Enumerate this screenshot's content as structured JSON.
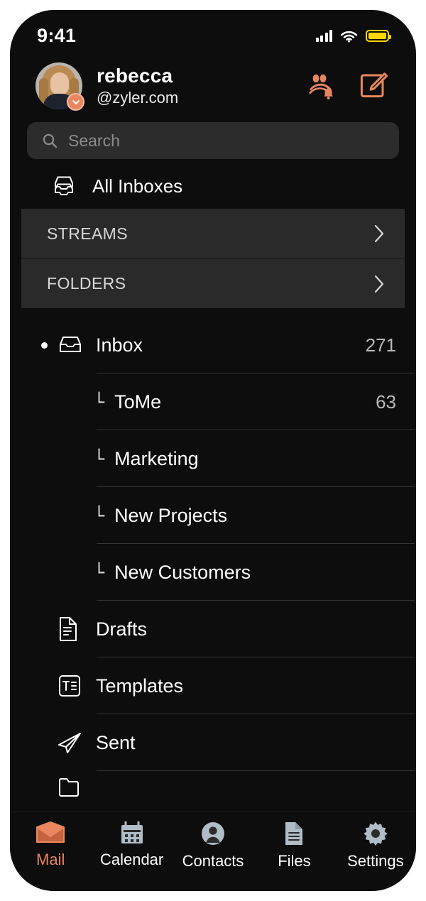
{
  "status_bar": {
    "time": "9:41",
    "signal_icon": "cellular-signal-icon",
    "wifi_icon": "wifi-icon",
    "battery_icon": "battery-icon",
    "battery_color": "#ffd60a"
  },
  "account": {
    "name": "rebecca",
    "domain": "@zyler.com",
    "avatar_name": "user-avatar",
    "avatar_badge_icon": "chevron-down-icon",
    "actions": [
      {
        "icon": "contacts-notification-icon",
        "color": "#e8875f"
      },
      {
        "icon": "compose-icon",
        "color": "#e8875f"
      }
    ]
  },
  "search": {
    "placeholder": "Search",
    "value": "",
    "icon": "search-icon"
  },
  "all_inboxes": {
    "label": "All Inboxes",
    "icon": "all-inboxes-tray-icon"
  },
  "sections": [
    {
      "title": "STREAMS",
      "chevron": "chevron-right-icon"
    },
    {
      "title": "FOLDERS",
      "chevron": "chevron-right-icon"
    }
  ],
  "mailboxes": [
    {
      "label": "Inbox",
      "count": "271",
      "icon": "inbox-tray-icon",
      "level": 0,
      "unread_dot": true
    },
    {
      "label": "ToMe",
      "count": "63",
      "icon": "branch-icon",
      "level": 1,
      "branch": "└"
    },
    {
      "label": "Marketing",
      "count": "",
      "icon": "branch-icon",
      "level": 1,
      "branch": "└"
    },
    {
      "label": "New Projects",
      "count": "",
      "icon": "branch-icon",
      "level": 1,
      "branch": "└"
    },
    {
      "label": "New Customers",
      "count": "",
      "icon": "branch-icon",
      "level": 1,
      "branch": "└"
    },
    {
      "label": "Drafts",
      "count": "",
      "icon": "drafts-document-icon",
      "level": 0,
      "unread_dot": false
    },
    {
      "label": "Templates",
      "count": "",
      "icon": "templates-icon",
      "level": 0,
      "unread_dot": false
    },
    {
      "label": "Sent",
      "count": "",
      "icon": "sent-paper-plane-icon",
      "level": 0,
      "unread_dot": false
    }
  ],
  "tabs": [
    {
      "label": "Mail",
      "icon": "mail-envelope-icon",
      "active": true
    },
    {
      "label": "Calendar",
      "icon": "calendar-icon",
      "active": false
    },
    {
      "label": "Contacts",
      "icon": "contacts-person-icon",
      "active": false
    },
    {
      "label": "Files",
      "icon": "files-document-icon",
      "active": false
    },
    {
      "label": "Settings",
      "icon": "settings-gear-icon",
      "active": false
    }
  ],
  "colors": {
    "accent": "#e8875f",
    "background": "#0d0d0d",
    "band": "#2a2a2a",
    "search_field": "#2c2c2c",
    "tab_inactive_icon": "#b0bcc6"
  }
}
